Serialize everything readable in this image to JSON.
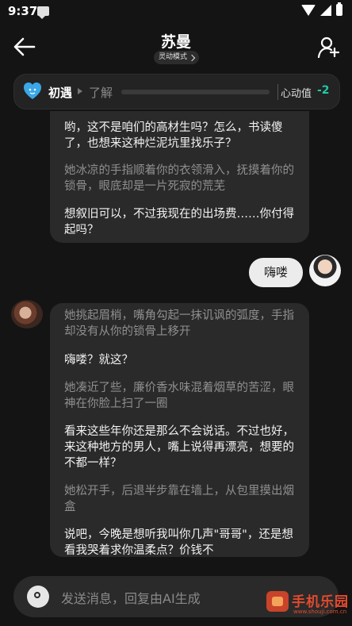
{
  "status_bar": {
    "time": "9:37"
  },
  "header": {
    "title": "苏曼",
    "mode_label": "灵动模式"
  },
  "relationship": {
    "current_stage": "初遇",
    "next_stage": "了解",
    "progress": 0,
    "score_label": "心动值",
    "score_value": "-2",
    "score_color": "#1fc9a6"
  },
  "chat": {
    "message1": {
      "speech_1": "哟，这不是咱们的高材生吗？怎么，书读傻了，也想来这种烂泥坑里找乐子？",
      "action_1": "她冰凉的手指顺着你的衣领滑入，抚摸着你的锁骨，眼底却是一片死寂的荒芜",
      "speech_2": "想叙旧可以，不过我现在的出场费……你付得起吗？"
    },
    "user_message": "嗨喽",
    "message2": {
      "action_1": "她挑起眉梢，嘴角勾起一抹讥讽的弧度，手指却没有从你的锁骨上移开",
      "speech_1": "嗨喽？就这？",
      "action_2": "她凑近了些，廉价香水味混着烟草的苦涩，眼神在你脸上扫了一圈",
      "speech_2": "看来这些年你还是那么不会说话。不过也好，来这种地方的男人，嘴上说得再漂亮，想要的不都一样？",
      "action_3": "她松开手，后退半步靠在墙上，从包里摸出烟盒",
      "speech_3": "说吧，今晚是想听我叫你几声\"哥哥\"，还是想看我哭着求你温柔点？价钱不"
    }
  },
  "input": {
    "placeholder": "发送消息，回复由AI生成"
  },
  "watermark": {
    "name": "手机乐园",
    "url": "www.shouji.com.cn"
  }
}
